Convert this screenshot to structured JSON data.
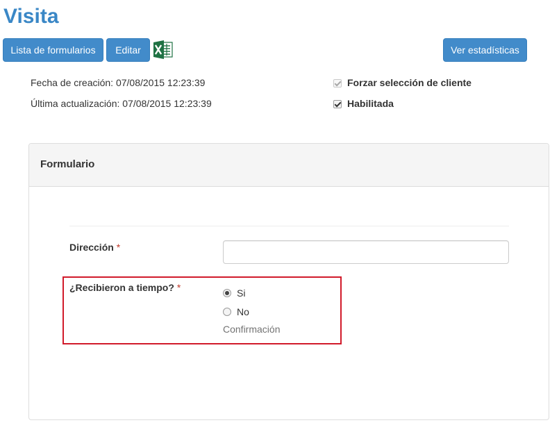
{
  "header": {
    "title": "Visita"
  },
  "toolbar": {
    "list_forms_label": "Lista de formularios",
    "edit_label": "Editar",
    "excel_icon": "excel-icon",
    "stats_label": "Ver estadísticas"
  },
  "meta": {
    "created": "Fecha de creación: 07/08/2015 12:23:39",
    "updated": "Última actualización: 07/08/2015 12:23:39"
  },
  "flags": {
    "force_client_label": "Forzar selección de cliente",
    "force_client_checked": true,
    "force_client_disabled": true,
    "enabled_label": "Habilitada",
    "enabled_checked": true
  },
  "form": {
    "panel_title": "Formulario",
    "fields": {
      "direccion": {
        "label": "Dirección",
        "required_mark": "*",
        "value": ""
      },
      "recibieron": {
        "label": "¿Recibieron a tiempo?",
        "required_mark": "*",
        "options": [
          "Si",
          "No"
        ],
        "selected": "Si",
        "help": "Confirmación"
      }
    }
  },
  "colors": {
    "title": "#3a87c6",
    "button": "#428bca",
    "highlight_border": "#d11a2a",
    "excel_green": "#1f7244"
  }
}
